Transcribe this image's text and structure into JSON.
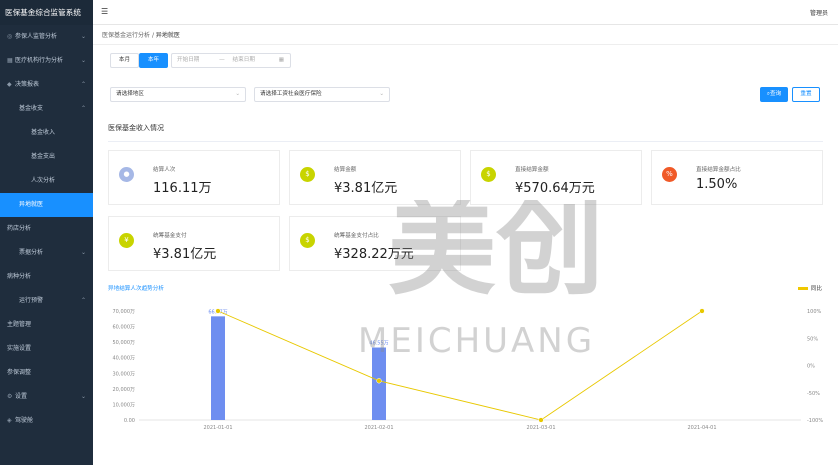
{
  "app": {
    "title": "医保基金综合监管系统",
    "user": "管理员"
  },
  "sidebar": {
    "items": [
      {
        "label": "参保人监管分析",
        "arrow": "⌄"
      },
      {
        "label": "医疗机构行为分析",
        "arrow": "⌄"
      },
      {
        "label": "决策报表",
        "arrow": "⌃"
      },
      {
        "label": "基金收支",
        "arrow": "⌃"
      },
      {
        "label": "基金收入"
      },
      {
        "label": "基金支出"
      },
      {
        "label": "人次分析"
      },
      {
        "label": "异地就医"
      },
      {
        "label": "药店分析"
      },
      {
        "label": "票据分析",
        "arrow": "⌄"
      },
      {
        "label": "病种分析"
      },
      {
        "label": "运行预警",
        "arrow": "⌃"
      },
      {
        "label": "主题管理"
      },
      {
        "label": "实施设置"
      },
      {
        "label": "参保调整"
      },
      {
        "label": "设置",
        "arrow": "⌄"
      },
      {
        "label": "驾驶舱"
      }
    ]
  },
  "breadcrumb": {
    "parent": "医保基金运行分析",
    "sep": "/",
    "current": "异地就医"
  },
  "filters": {
    "month_label": "本月",
    "year_label": "本年",
    "start_placeholder": "开始日期",
    "range_sep": "—",
    "end_placeholder": "结束日期",
    "region_value": "请选择地区",
    "type_value": "请选择工资社会医疗保险",
    "query_label": "查询",
    "reset_label": "重置"
  },
  "section_title": "医保基金收入情况",
  "cards": [
    {
      "label": "结算人次",
      "value": "116.11万",
      "icon": "user-icon",
      "color": "#a6b8e6"
    },
    {
      "label": "结算金额",
      "value": "¥3.81亿元",
      "icon": "money-bag-icon",
      "color": "#c8d400"
    },
    {
      "label": "直接结算金额",
      "value": "¥570.64万元",
      "icon": "money-bag-icon",
      "color": "#c8d400"
    },
    {
      "label": "直接结算金额占比",
      "value": "1.50%",
      "icon": "percent-icon",
      "color": "#f05a28"
    },
    {
      "label": "统筹基金支付",
      "value": "¥3.81亿元",
      "icon": "coin-icon",
      "color": "#c8d400"
    },
    {
      "label": "统筹基金支付占比",
      "value": "¥328.22万元",
      "icon": "money-bag-icon",
      "color": "#c8d400"
    }
  ],
  "chart_title": "异地结算人次趋势分析",
  "legend": {
    "name": "同比"
  },
  "watermark": {
    "text": "美创",
    "sub": "MEICHUANG"
  },
  "chart_data": {
    "type": "bar",
    "categories": [
      "2021-01-01",
      "2021-02-01",
      "2021-03-01",
      "2021-04-01"
    ],
    "series": [
      {
        "name": "结算人次",
        "type": "bar",
        "values": [
          66.57,
          46.55,
          0,
          0
        ],
        "labels": [
          "66.57万",
          "46.55万",
          "",
          ""
        ],
        "color": "#6e8ef0"
      },
      {
        "name": "同比",
        "type": "line",
        "values": [
          100,
          -28,
          -100,
          100
        ],
        "color": "#e8c800"
      }
    ],
    "y_left": {
      "ticks": [
        "0.00",
        "10,000万",
        "20,000万",
        "30,000万",
        "40,000万",
        "50,000万",
        "60,000万",
        "70,000万"
      ],
      "max": 70
    },
    "y_right": {
      "ticks": [
        "-100%",
        "-50%",
        "0%",
        "50%",
        "100%"
      ],
      "min": -100,
      "max": 100
    }
  }
}
